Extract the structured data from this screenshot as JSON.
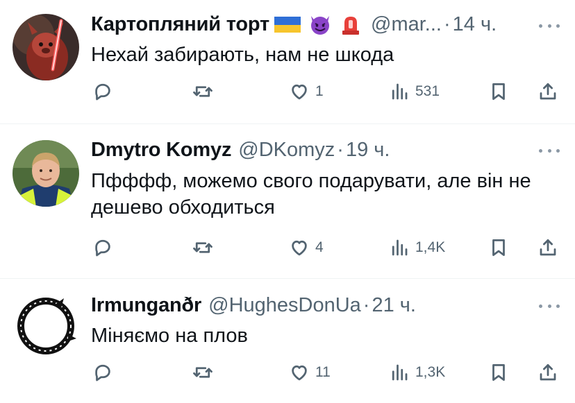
{
  "tweets": [
    {
      "name": "Картопляний торт",
      "emojis": [
        "ukraine-flag",
        "smiling-devil",
        "police-light"
      ],
      "handle": "@mar...",
      "dot": "·",
      "time": "14 ч.",
      "text": "Нехай забирають, нам не шкода",
      "likes": "1",
      "views": "531"
    },
    {
      "name": "Dmytro Komyz",
      "handle": "@DKomyz",
      "dot": "·",
      "time": "19 ч.",
      "text": "Пфффф, можемо свого подарувати, але він не дешево обходиться",
      "likes": "4",
      "views": "1,4K"
    },
    {
      "name": "Irmunganðr",
      "handle": "@HughesDonUa",
      "dot": "·",
      "time": "21 ч.",
      "text": "Міняємо на плов",
      "likes": "11",
      "views": "1,3K"
    }
  ],
  "colors": {
    "text": "#0f1419",
    "secondary": "#536471",
    "separator": "#eff3f4"
  }
}
